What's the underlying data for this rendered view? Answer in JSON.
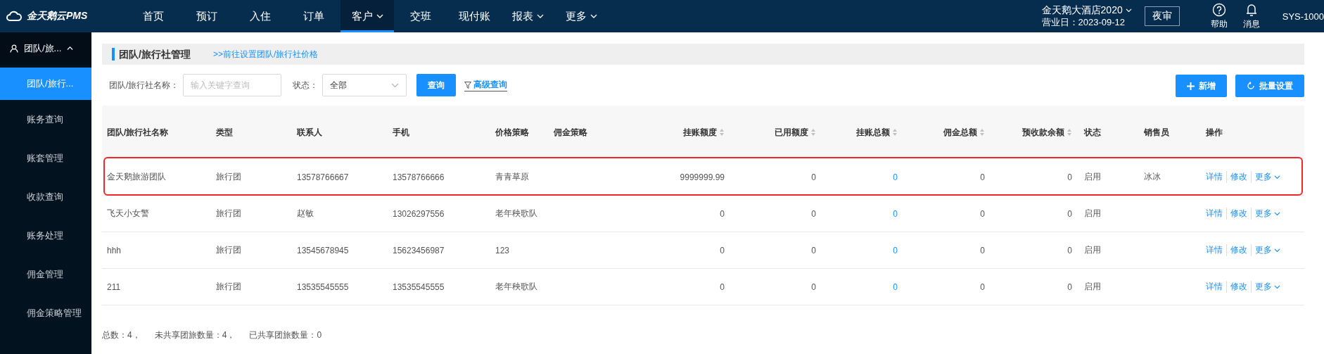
{
  "app": {
    "logo": "金天鹅云PMS"
  },
  "nav": [
    {
      "label": "首页",
      "selected": false,
      "dropdown": false
    },
    {
      "label": "预订",
      "selected": false,
      "dropdown": false
    },
    {
      "label": "入住",
      "selected": false,
      "dropdown": false
    },
    {
      "label": "订单",
      "selected": false,
      "dropdown": false
    },
    {
      "label": "客户",
      "selected": true,
      "dropdown": true
    },
    {
      "label": "交班",
      "selected": false,
      "dropdown": false
    },
    {
      "label": "现付账",
      "selected": false,
      "dropdown": false
    },
    {
      "label": "报表",
      "selected": false,
      "dropdown": true
    },
    {
      "label": "更多",
      "selected": false,
      "dropdown": true
    }
  ],
  "hotel": {
    "name": "金天鹅大酒店2020",
    "business_date": "营业日：2023-09-12",
    "night_audit": "夜审"
  },
  "top_actions": [
    {
      "kind": "help",
      "label": "帮助"
    },
    {
      "kind": "bell",
      "label": "消息"
    }
  ],
  "user": "SYS-1000",
  "sidebar": {
    "group": {
      "label": "团队/旅...",
      "expanded": true
    },
    "items": [
      {
        "label": "团队/旅行...",
        "selected": true
      },
      {
        "label": "账务查询",
        "selected": false
      },
      {
        "label": "账套管理",
        "selected": false
      },
      {
        "label": "收款查询",
        "selected": false
      },
      {
        "label": "账务处理",
        "selected": false
      },
      {
        "label": "佣金管理",
        "selected": false
      },
      {
        "label": "佣金策略管理",
        "selected": false
      }
    ]
  },
  "page": {
    "title": "团队/旅行社管理",
    "link": ">>前往设置团队/旅行社价格"
  },
  "filters": {
    "name_label": "团队/旅行社名称：",
    "name_placeholder": "输入关键字查询",
    "status_label": "状态：",
    "status_value": "全部",
    "search": "查询",
    "advanced": "高级查询"
  },
  "actions": [
    {
      "kind": "add",
      "label": "新增"
    },
    {
      "kind": "batch",
      "label": "批量设置"
    }
  ],
  "table": {
    "columns": [
      {
        "label": "团队/旅行社名称",
        "kind": "text",
        "sortable": false
      },
      {
        "label": "类型",
        "kind": "text",
        "sortable": false
      },
      {
        "label": "联系人",
        "kind": "text",
        "sortable": false
      },
      {
        "label": "手机",
        "kind": "text",
        "sortable": false
      },
      {
        "label": "价格策略",
        "kind": "text",
        "sortable": false
      },
      {
        "label": "佣金策略",
        "kind": "text",
        "sortable": false
      },
      {
        "label": "挂账额度",
        "kind": "number",
        "sortable": true
      },
      {
        "label": "已用额度",
        "kind": "number",
        "sortable": true
      },
      {
        "label": "挂账总额",
        "kind": "link",
        "sortable": true
      },
      {
        "label": "佣金总额",
        "kind": "number",
        "sortable": true
      },
      {
        "label": "预收款余额",
        "kind": "number",
        "sortable": true
      },
      {
        "label": "状态",
        "kind": "text",
        "sortable": false
      },
      {
        "label": "销售员",
        "kind": "text",
        "sortable": false
      },
      {
        "label": "操作",
        "kind": "actions",
        "sortable": false
      }
    ],
    "rows": [
      {
        "highlighted": true,
        "cells": [
          "金天鹅旅游团队",
          "旅行团",
          "13578766667",
          "13578766666",
          "青青草原",
          "",
          "9999999.99",
          "0",
          "0",
          "0",
          "0",
          "启用",
          "冰冰"
        ],
        "actions": [
          "详情",
          "修改",
          "更多"
        ]
      },
      {
        "highlighted": false,
        "cells": [
          "飞天小女警",
          "旅行团",
          "赵敏",
          "13026297556",
          "老年秧歌队",
          "",
          "0",
          "0",
          "0",
          "0",
          "0",
          "启用",
          ""
        ],
        "actions": [
          "详情",
          "修改",
          "更多"
        ]
      },
      {
        "highlighted": false,
        "cells": [
          "hhh",
          "旅行团",
          "13545678945",
          "15623456987",
          "123",
          "",
          "0",
          "0",
          "0",
          "0",
          "0",
          "启用",
          ""
        ],
        "actions": [
          "详情",
          "修改",
          "更多"
        ]
      },
      {
        "highlighted": false,
        "cells": [
          "211",
          "旅行团",
          "13535545555",
          "13535545555",
          "老年秧歌队",
          "",
          "0",
          "0",
          "0",
          "0",
          "0",
          "启用",
          ""
        ],
        "actions": [
          "详情",
          "修改",
          "更多"
        ]
      }
    ]
  },
  "summary": [
    "总数：4，",
    "未共享团旅数量：4，",
    "已共享团旅数量：0"
  ]
}
